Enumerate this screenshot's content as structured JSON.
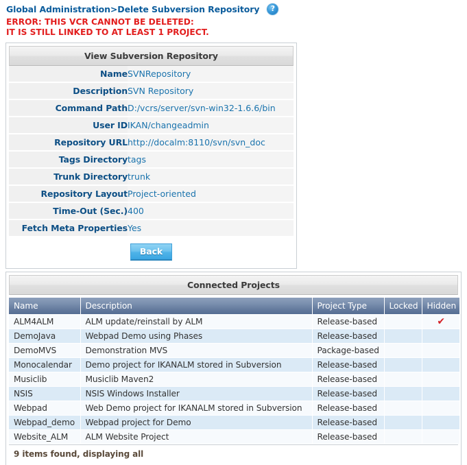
{
  "header": {
    "breadcrumb": "Global Administration>Delete Subversion Repository",
    "help_icon": "help-icon",
    "help_glyph": "?"
  },
  "error": {
    "line1": "ERROR: THIS VCR CANNOT BE DELETED:",
    "line2": "IT IS STILL LINKED TO AT LEAST 1 PROJECT.",
    "color": "#e21e1e"
  },
  "details": {
    "title": "View Subversion Repository",
    "rows": [
      {
        "label": "Name",
        "value": "SVNRepository"
      },
      {
        "label": "Description",
        "value": "SVN Repository"
      },
      {
        "label": "Command Path",
        "value": "D:/vcrs/server/svn-win32-1.6.6/bin"
      },
      {
        "label": "User ID",
        "value": "IKAN/changeadmin"
      },
      {
        "label": "Repository URL",
        "value": "http://docalm:8110/svn/svn_doc"
      },
      {
        "label": "Tags Directory",
        "value": "tags"
      },
      {
        "label": "Trunk Directory",
        "value": "trunk"
      },
      {
        "label": "Repository Layout",
        "value": "Project-oriented"
      },
      {
        "label": "Time-Out (Sec.)",
        "value": "400"
      },
      {
        "label": "Fetch Meta Properties",
        "value": "Yes"
      }
    ],
    "back_label": "Back"
  },
  "projects": {
    "title": "Connected Projects",
    "columns": [
      "Name",
      "Description",
      "Project Type",
      "Locked",
      "Hidden"
    ],
    "rows": [
      {
        "name": "ALM4ALM",
        "description": "ALM update/reinstall by ALM",
        "type": "Release-based",
        "locked": "",
        "hidden": "✔"
      },
      {
        "name": "DemoJava",
        "description": "Webpad Demo using Phases",
        "type": "Release-based",
        "locked": "",
        "hidden": ""
      },
      {
        "name": "DemoMVS",
        "description": "Demonstration MVS",
        "type": "Package-based",
        "locked": "",
        "hidden": ""
      },
      {
        "name": "Monocalendar",
        "description": "Demo project for IKANALM stored in Subversion",
        "type": "Release-based",
        "locked": "",
        "hidden": ""
      },
      {
        "name": "Musiclib",
        "description": "Musiclib Maven2",
        "type": "Release-based",
        "locked": "",
        "hidden": ""
      },
      {
        "name": "NSIS",
        "description": "NSIS Windows Installer",
        "type": "Release-based",
        "locked": "",
        "hidden": ""
      },
      {
        "name": "Webpad",
        "description": "Web Demo project for IKANALM stored in Subversion",
        "type": "Release-based",
        "locked": "",
        "hidden": ""
      },
      {
        "name": "Webpad_demo",
        "description": "Webpad project for Demo",
        "type": "Release-based",
        "locked": "",
        "hidden": ""
      },
      {
        "name": "Website_ALM",
        "description": "ALM Website Project",
        "type": "Release-based",
        "locked": "",
        "hidden": ""
      }
    ],
    "footer": "9 items found, displaying all"
  }
}
